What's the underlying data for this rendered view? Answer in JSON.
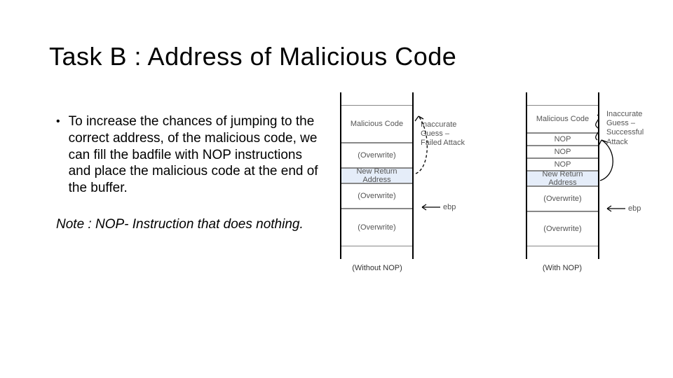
{
  "title": "Task B : Address of Malicious Code",
  "bullet": "To increase the chances of jumping to the correct address, of the malicious code, we can fill the badfile with NOP instructions and place the malicious code at the end of the buffer.",
  "note": "Note : NOP- Instruction that does nothing.",
  "diagram": {
    "left": {
      "cells": [
        "Malicious Code",
        "(Overwrite)",
        "New Return Address",
        "(Overwrite)",
        "(Overwrite)"
      ],
      "caption": "(Without NOP)",
      "side_label": "Inaccurate Guess – Failed Attack",
      "pointer": "ebp"
    },
    "right": {
      "cells": [
        "Malicious Code",
        "NOP",
        "NOP",
        "NOP",
        "New Return Address",
        "(Overwrite)",
        "(Overwrite)"
      ],
      "caption": "(With NOP)",
      "side_label": "Inaccurate Guess – Successful Attack",
      "pointer": "ebp"
    }
  }
}
